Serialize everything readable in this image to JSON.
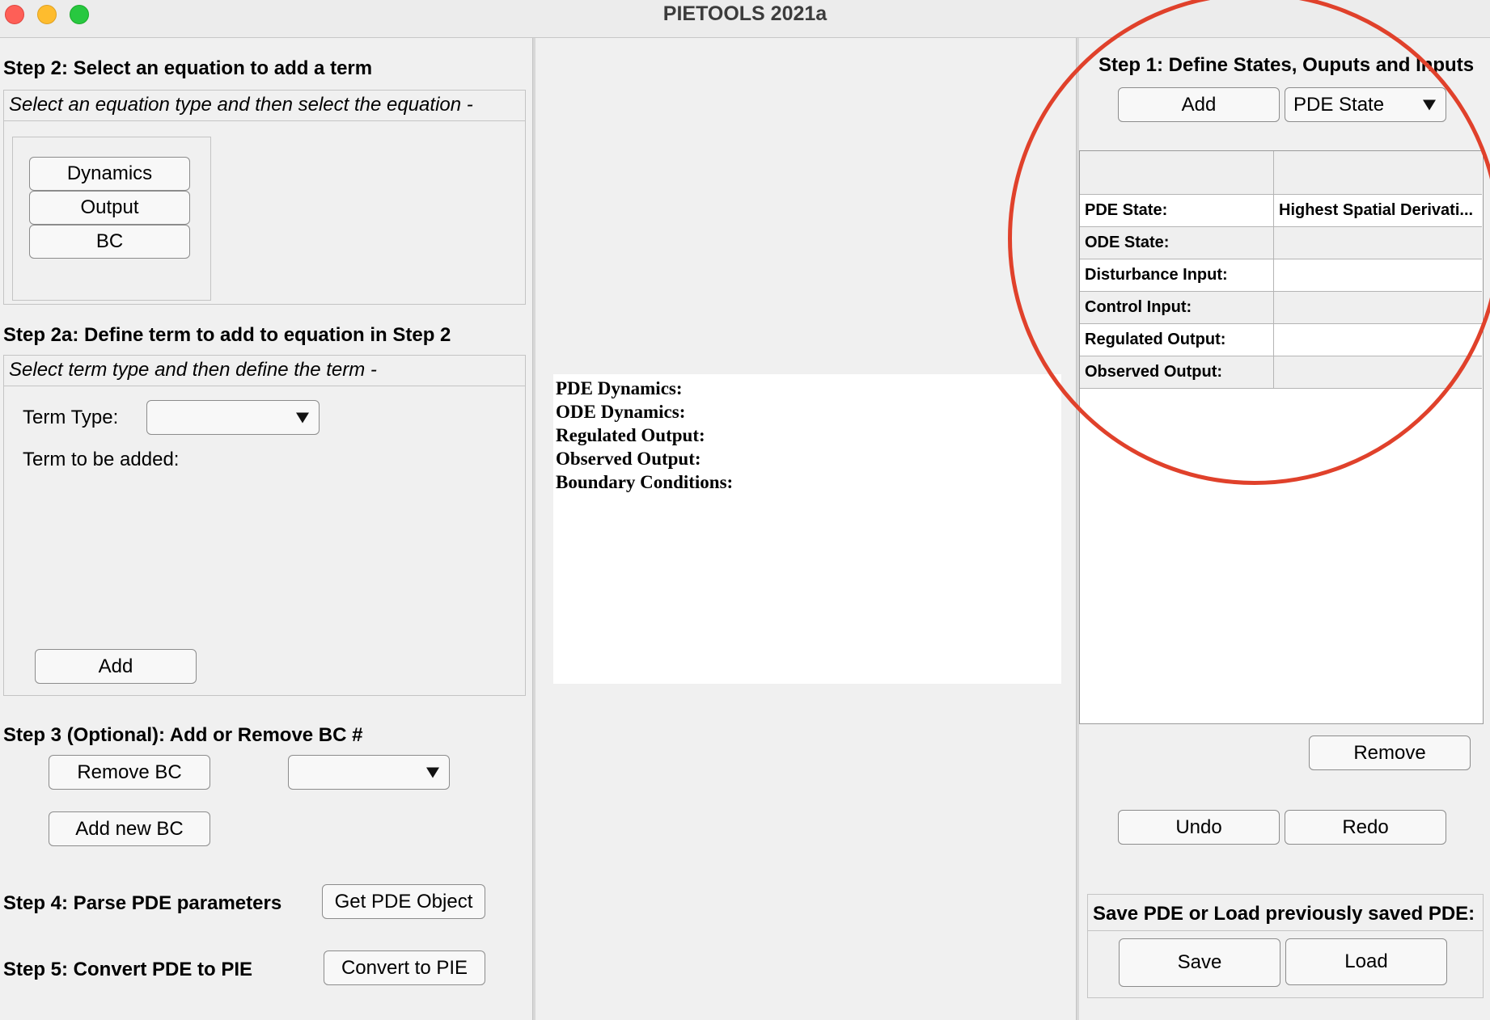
{
  "window": {
    "title": "PIETOOLS 2021a"
  },
  "step2": {
    "heading": "Step 2: Select an equation to add a term",
    "instruction": "Select an equation type and then select the equation -",
    "buttons": [
      "Dynamics",
      "Output",
      "BC"
    ]
  },
  "step2a": {
    "heading": "Step 2a: Define term to add to equation in Step 2",
    "instruction": "Select term type and then define the term -",
    "term_type_label": "Term Type:",
    "term_type_value": "",
    "term_added_label": "Term to be added:",
    "add_label": "Add"
  },
  "step3": {
    "heading": "Step 3 (Optional): Add or Remove BC #",
    "remove_label": "Remove BC",
    "bc_select_value": "",
    "add_label": "Add new BC"
  },
  "step4": {
    "heading": "Step 4: Parse PDE parameters",
    "button_label": "Get PDE Object"
  },
  "step5": {
    "heading": "Step 5: Convert PDE to PIE",
    "button_label": "Convert to PIE"
  },
  "summary": {
    "lines": [
      "PDE Dynamics:",
      "ODE Dynamics:",
      "Regulated Output:",
      "Observed Output:",
      "Boundary Conditions:"
    ]
  },
  "step1": {
    "heading": "Step 1: Define States, Ouputs and Inputs",
    "add_label": "Add",
    "type_select_value": "PDE State",
    "table": {
      "header": [
        "",
        ""
      ],
      "rows": [
        {
          "label": "PDE State:",
          "value": "Highest Spatial Derivati..."
        },
        {
          "label": "ODE State:",
          "value": ""
        },
        {
          "label": "Disturbance Input:",
          "value": ""
        },
        {
          "label": "Control Input:",
          "value": ""
        },
        {
          "label": "Regulated Output:",
          "value": ""
        },
        {
          "label": "Observed Output:",
          "value": ""
        }
      ]
    },
    "remove_label": "Remove",
    "undo_label": "Undo",
    "redo_label": "Redo"
  },
  "saveload": {
    "heading": "Save PDE or Load previously saved PDE:",
    "save_label": "Save",
    "load_label": "Load"
  },
  "colors": {
    "annotation_circle": "#e0412b"
  }
}
